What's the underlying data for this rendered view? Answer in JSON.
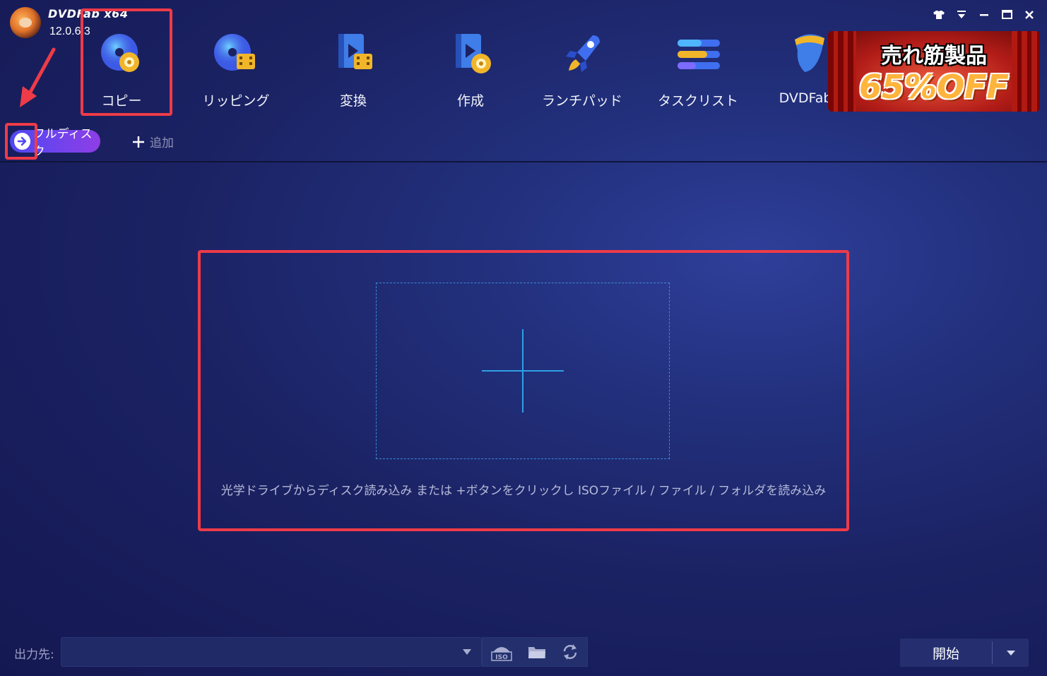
{
  "app": {
    "title": "DVDFab x64",
    "version": "12.0.6.3"
  },
  "window_controls": [
    "skin-icon",
    "menu-icon",
    "minimize-icon",
    "maximize-icon",
    "close-icon"
  ],
  "nav": {
    "items": [
      {
        "label": "コピー",
        "icon": "copy-disc-icon",
        "active": true
      },
      {
        "label": "リッピング",
        "icon": "ripper-disc-icon"
      },
      {
        "label": "変換",
        "icon": "converter-film-icon"
      },
      {
        "label": "作成",
        "icon": "creator-film-icon"
      },
      {
        "label": "ランチパッド",
        "icon": "rocket-icon"
      },
      {
        "label": "タスクリスト",
        "icon": "task-list-icon"
      },
      {
        "label": "DVDFab",
        "icon": "dvdfab-product-icon"
      }
    ]
  },
  "ad": {
    "line1": "売れ筋製品",
    "line2": "65%OFF"
  },
  "subbar": {
    "mode_label": "フルディスク",
    "add_label": "追加"
  },
  "drop_area": {
    "hint": "光学ドライブからディスク読み込み または +ボタンをクリックし ISOファイル / ファイル / フォルダを読み込み"
  },
  "bottom": {
    "output_label": "出力先:",
    "output_value": "",
    "start_label": "開始"
  },
  "colors": {
    "highlight": "#ee3b48",
    "accent_blue": "#2ea0e6",
    "mode_button_start": "#4f48f2",
    "mode_button_end": "#8e3ee6"
  }
}
